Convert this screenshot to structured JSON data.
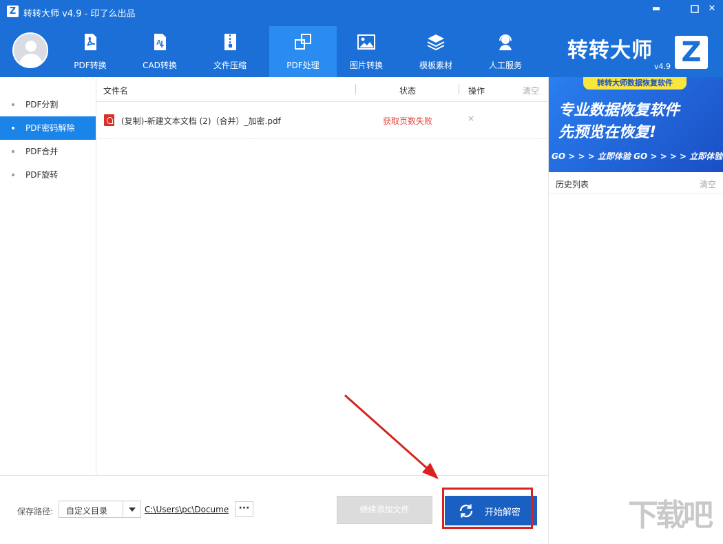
{
  "window": {
    "logo_glyph": "Z",
    "title": "转转大师 v4.9 - 印了么出品",
    "minimize": "▬",
    "maximize": "☐",
    "close": "✕"
  },
  "nav": {
    "items": [
      {
        "label": "PDF转换",
        "icon": "pdf-icon"
      },
      {
        "label": "CAD转换",
        "icon": "cad-icon"
      },
      {
        "label": "文件压缩",
        "icon": "zip-icon"
      },
      {
        "label": "PDF处理",
        "icon": "pdf-process-icon",
        "active": true
      },
      {
        "label": "图片转换",
        "icon": "image-icon"
      },
      {
        "label": "模板素材",
        "icon": "layers-icon"
      },
      {
        "label": "人工服务",
        "icon": "support-icon"
      }
    ]
  },
  "brand": {
    "name": "转转大师",
    "version": "v4.9",
    "logo_glyph": "Z"
  },
  "sidebar": {
    "items": [
      {
        "label": "PDF分割"
      },
      {
        "label": "PDF密码解除",
        "active": true
      },
      {
        "label": "PDF合并"
      },
      {
        "label": "PDF旋转"
      }
    ]
  },
  "list": {
    "headers": {
      "file_name": "文件名",
      "status": "状态",
      "action": "操作",
      "clear": "清空"
    },
    "rows": [
      {
        "file_name": "(复制)-新建文本文档 (2)（合并）_加密.pdf",
        "status": "获取页数失败",
        "remove": "×"
      }
    ]
  },
  "ad": {
    "tag": "转转大师数据恢复软件",
    "line1": "专业数据恢复软件",
    "line2": "先预览在恢复!",
    "strip": "GO > > > 立即体验  GO > > > > 立即体验"
  },
  "history": {
    "title": "历史列表",
    "clear": "清空"
  },
  "bottom": {
    "path_label": "保存路径:",
    "select_value": "自定义目录",
    "path_value": "C:\\Users\\pc\\Docume",
    "browse": "···",
    "add_button": "继续添加文件",
    "start_button": "开始解密"
  },
  "watermark": "下载吧",
  "colors": {
    "header": "#1b6fd6",
    "nav_active": "#2a8cf0",
    "sidebar_active": "#1b84e8",
    "start_button": "#1a5fc2",
    "status_error": "#e5483f",
    "annotation": "#d8221d"
  }
}
